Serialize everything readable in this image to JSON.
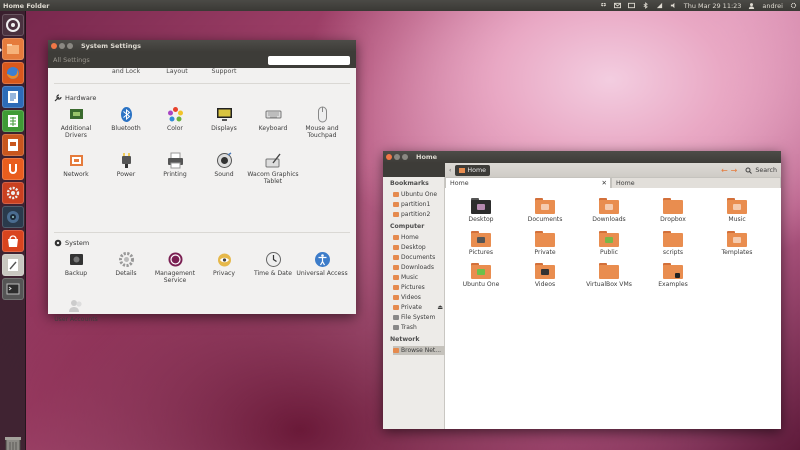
{
  "topbar": {
    "app_title": "Home Folder",
    "datetime": "Thu Mar 29 11:23",
    "user": "andrei"
  },
  "launcher": {
    "items": [
      "dash-icon",
      "home-folder-icon",
      "firefox-icon",
      "writer-icon",
      "calc-icon",
      "impress-icon",
      "ubuntu-one-icon",
      "settings-icon",
      "disks-icon",
      "software-center-icon",
      "text-editor-icon",
      "terminal-icon"
    ],
    "trash": "trash-icon"
  },
  "settings": {
    "title": "System Settings",
    "breadcrumb": "All Settings",
    "search_placeholder": "",
    "cut_labels": [
      "and Lock",
      "Layout",
      "Support"
    ],
    "hardware": {
      "heading": "Hardware",
      "items": [
        "Additional Drivers",
        "Bluetooth",
        "Color",
        "Displays",
        "Keyboard",
        "Mouse and Touchpad",
        "Network",
        "Power",
        "Printing",
        "Sound",
        "Wacom Graphics Tablet"
      ]
    },
    "system": {
      "heading": "System",
      "items": [
        "Backup",
        "Details",
        "Management Service",
        "Privacy",
        "Time & Date",
        "Universal Access",
        "User Accounts"
      ]
    }
  },
  "files": {
    "title": "Home",
    "path_button": "Home",
    "search_label": "Search",
    "sidebar": {
      "bookmarks_heading": "Bookmarks",
      "bookmarks": [
        "Ubuntu One",
        "partition1",
        "partition2"
      ],
      "computer_heading": "Computer",
      "computer": [
        "Home",
        "Desktop",
        "Documents",
        "Downloads",
        "Music",
        "Pictures",
        "Videos",
        "Private",
        "File System",
        "Trash"
      ],
      "network_heading": "Network",
      "network": [
        "Browse Net..."
      ]
    },
    "tabs": [
      "Home",
      "Home"
    ],
    "items": [
      "Desktop",
      "Documents",
      "Downloads",
      "Dropbox",
      "Music",
      "Pictures",
      "Private",
      "Public",
      "scripts",
      "Templates",
      "Ubuntu One",
      "Videos",
      "VirtualBox VMs",
      "Examples"
    ]
  }
}
